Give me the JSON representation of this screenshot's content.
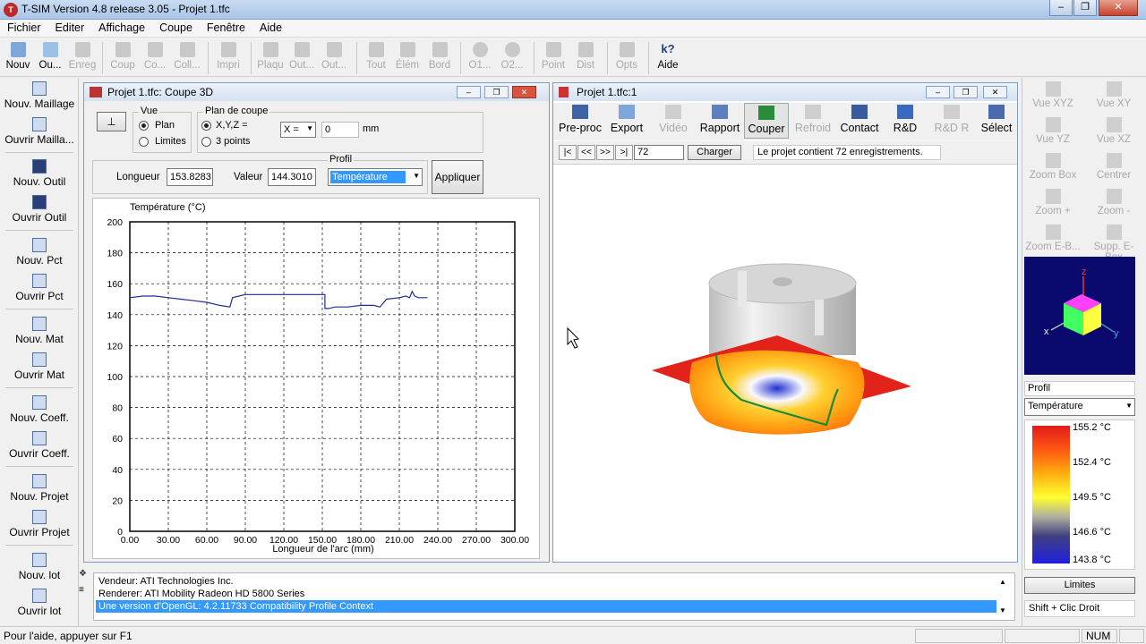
{
  "app": {
    "icon_text": "T",
    "title": "T-SIM Version 4.8 release 3.05 - Projet 1.tfc"
  },
  "window_controls": {
    "minimize": "–",
    "maximize": "❐",
    "close": "✕"
  },
  "menu": [
    "Fichier",
    "Editer",
    "Affichage",
    "Coupe",
    "Fenêtre",
    "Aide"
  ],
  "toolbar": [
    {
      "label": "Nouv",
      "enabled": true
    },
    {
      "label": "Ou...",
      "enabled": true
    },
    {
      "label": "Enreg",
      "enabled": false
    },
    {
      "label": "Coup",
      "enabled": false
    },
    {
      "label": "Co...",
      "enabled": false
    },
    {
      "label": "Coll...",
      "enabled": false
    },
    {
      "label": "Impri",
      "enabled": false
    },
    {
      "label": "Plaqu",
      "enabled": false
    },
    {
      "label": "Out...",
      "enabled": false
    },
    {
      "label": "Out...",
      "enabled": false
    },
    {
      "label": "Tout",
      "enabled": false
    },
    {
      "label": "Élém",
      "enabled": false
    },
    {
      "label": "Bord",
      "enabled": false
    },
    {
      "label": "O1...",
      "enabled": false
    },
    {
      "label": "O2...",
      "enabled": false
    },
    {
      "label": "Point",
      "enabled": false
    },
    {
      "label": "Dist",
      "enabled": false
    },
    {
      "label": "Opts",
      "enabled": false
    },
    {
      "label": "Aide",
      "enabled": true,
      "icon_text": "k?"
    }
  ],
  "leftbar": [
    {
      "line1": "Nouv. Maillage"
    },
    {
      "line1": "Ouvrir Mailla..."
    },
    {
      "line1": "Nouv. Outil"
    },
    {
      "line1": "Ouvrir Outil"
    },
    {
      "line1": "Nouv. Pct"
    },
    {
      "line1": "Ouvrir Pct"
    },
    {
      "line1": "Nouv. Mat"
    },
    {
      "line1": "Ouvrir Mat"
    },
    {
      "line1": "Nouv. Coeff."
    },
    {
      "line1": "Ouvrir Coeff."
    },
    {
      "line1": "Nouv. Projet"
    },
    {
      "line1": "Ouvrir Projet"
    },
    {
      "line1": "Nouv. lot"
    },
    {
      "line1": "Ouvrir lot"
    }
  ],
  "coupe_window": {
    "title": "Projet 1.tfc: Coupe 3D",
    "pin_icon": "⊥",
    "vue": {
      "label": "Vue",
      "options": [
        "Plan",
        "Limites"
      ],
      "selected": "Plan"
    },
    "plan": {
      "label": "Plan de coupe",
      "options": [
        "X,Y,Z =",
        "3 points"
      ],
      "selected": "X,Y,Z =",
      "axis": "X =",
      "value": "0",
      "unit": "mm"
    },
    "longueur_label": "Longueur",
    "longueur": "153.8283",
    "valeur_label": "Valeur",
    "valeur": "144.3010",
    "profil_label": "Profil",
    "profil": "Température",
    "appliquer": "Appliquer"
  },
  "chart_data": {
    "type": "line",
    "title": "",
    "ylabel": "Température (°C)",
    "xlabel": "Longueur de l'arc (mm)",
    "xlim": [
      0,
      300
    ],
    "ylim": [
      0,
      200
    ],
    "x_ticks": [
      "0.00",
      "30.00",
      "60.00",
      "90.00",
      "120.00",
      "150.00",
      "180.00",
      "210.00",
      "240.00",
      "270.00",
      "300.00"
    ],
    "y_ticks": [
      "0",
      "20",
      "40",
      "60",
      "80",
      "100",
      "120",
      "140",
      "160",
      "180",
      "200"
    ],
    "grid": true,
    "color": "#1f2f8f",
    "series": [
      {
        "x": [
          0,
          10,
          20,
          30,
          40,
          50,
          60,
          70,
          78,
          80,
          85,
          90,
          100,
          110,
          120,
          130,
          140,
          152,
          152,
          155,
          160,
          170,
          180,
          190,
          195,
          200,
          210,
          215,
          218,
          220,
          222,
          225,
          230,
          232
        ],
        "y": [
          151,
          152,
          152,
          151,
          150,
          149,
          148,
          146,
          145,
          151,
          152,
          153,
          153,
          153,
          153,
          153,
          153,
          153,
          144,
          144,
          145,
          145,
          146,
          146,
          145,
          150,
          151,
          152,
          151,
          155,
          152,
          151,
          151,
          151
        ]
      }
    ]
  },
  "view3d_window": {
    "title": "Projet 1.tfc:1",
    "tools": [
      {
        "label": "Pre-proc",
        "enabled": true
      },
      {
        "label": "Export",
        "enabled": true
      },
      {
        "label": "Vidéo",
        "enabled": false
      },
      {
        "label": "Rapport",
        "enabled": true
      },
      {
        "label": "Couper",
        "enabled": true,
        "active": true
      },
      {
        "label": "Refroid",
        "enabled": false
      },
      {
        "label": "Contact",
        "enabled": true
      },
      {
        "label": "R&D",
        "enabled": true
      },
      {
        "label": "R&D R",
        "enabled": false
      },
      {
        "label": "Sélect",
        "enabled": true
      }
    ],
    "nav": [
      "|<",
      "<<",
      ">>",
      ">|"
    ],
    "record": "72",
    "charger": "Charger",
    "message": "Le projet contient 72 enregistrements."
  },
  "rightbar": {
    "buttons": [
      "Vue XYZ",
      "Vue XY",
      "Vue YZ",
      "Vue XZ",
      "Zoom Box",
      "Centrer",
      "Zoom +",
      "Zoom -",
      "Zoom E-B...",
      "Supp. E-Box"
    ],
    "axes": {
      "z": "z",
      "x": "x",
      "y": "y"
    },
    "profil_label": "Profil",
    "profil": "Température",
    "legend": [
      "155.2 °C",
      "152.4 °C",
      "149.5 °C",
      "146.6 °C",
      "143.8 °C"
    ],
    "limites": "Limites",
    "hint": "Shift + Clic Droit"
  },
  "log": {
    "lines": [
      "Vendeur: ATI Technologies Inc.",
      "Renderer: ATI Mobility Radeon HD 5800 Series",
      "Une version d'OpenGL: 4.2.11733 Compatibility Profile Context"
    ]
  },
  "status": {
    "help": "Pour l'aide, appuyer sur F1",
    "num": "NUM"
  }
}
